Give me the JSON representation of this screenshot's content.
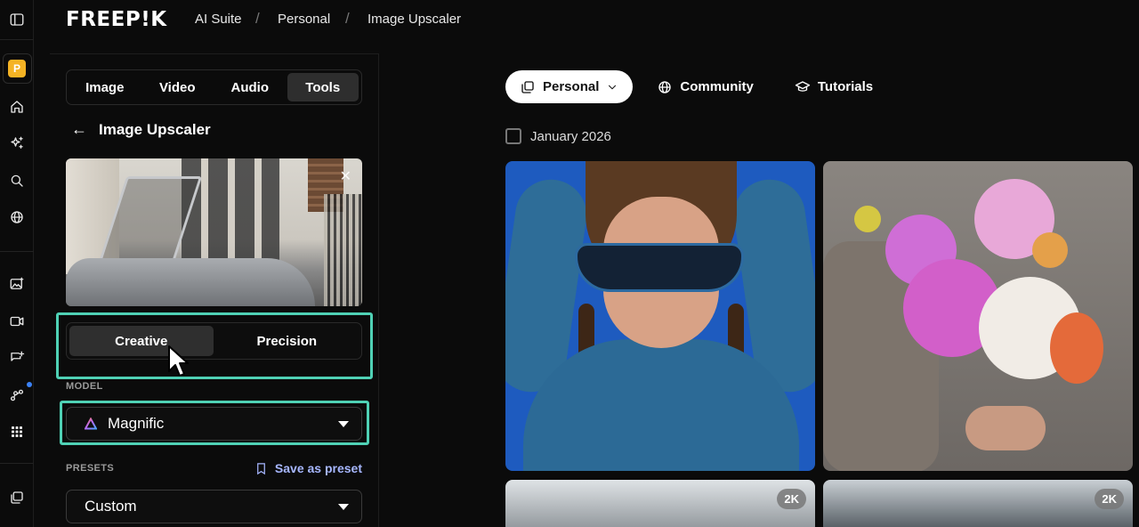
{
  "brand": {
    "logo": "FREEP!K",
    "accent": "#4fd1b5",
    "link_color": "#a7b7ff"
  },
  "breadcrumb": {
    "items": [
      "AI Suite",
      "Personal",
      "Image Upscaler"
    ],
    "separator": "/"
  },
  "rail": {
    "badge_letter": "P",
    "icons": [
      "sidebar-toggle-icon",
      "home-icon",
      "sparkle-icon",
      "search-icon",
      "globe-icon",
      "image-edit-icon",
      "video-icon",
      "chat-add-icon",
      "workflow-icon",
      "apps-grid-icon",
      "gallery-icon"
    ]
  },
  "panel": {
    "tabs": [
      {
        "label": "Image",
        "active": false
      },
      {
        "label": "Video",
        "active": false
      },
      {
        "label": "Audio",
        "active": false
      },
      {
        "label": "Tools",
        "active": true
      }
    ],
    "back_arrow": "←",
    "title": "Image Upscaler",
    "close_glyph": "✕",
    "mode": {
      "options": [
        "Creative",
        "Precision"
      ],
      "selected": "Creative"
    },
    "model": {
      "label": "MODEL",
      "value": "Magnific"
    },
    "presets": {
      "label": "PRESETS",
      "save_label": "Save as preset",
      "value": "Custom"
    }
  },
  "main": {
    "filter": {
      "selected": "Personal",
      "links": [
        "Community",
        "Tutorials"
      ]
    },
    "date_group": "January 2026",
    "cards": [
      {
        "subject": "portrait"
      },
      {
        "subject": "flowers"
      },
      {
        "subject": "stadium",
        "badge": "2K"
      },
      {
        "subject": "stadium",
        "badge": "2K"
      }
    ]
  }
}
